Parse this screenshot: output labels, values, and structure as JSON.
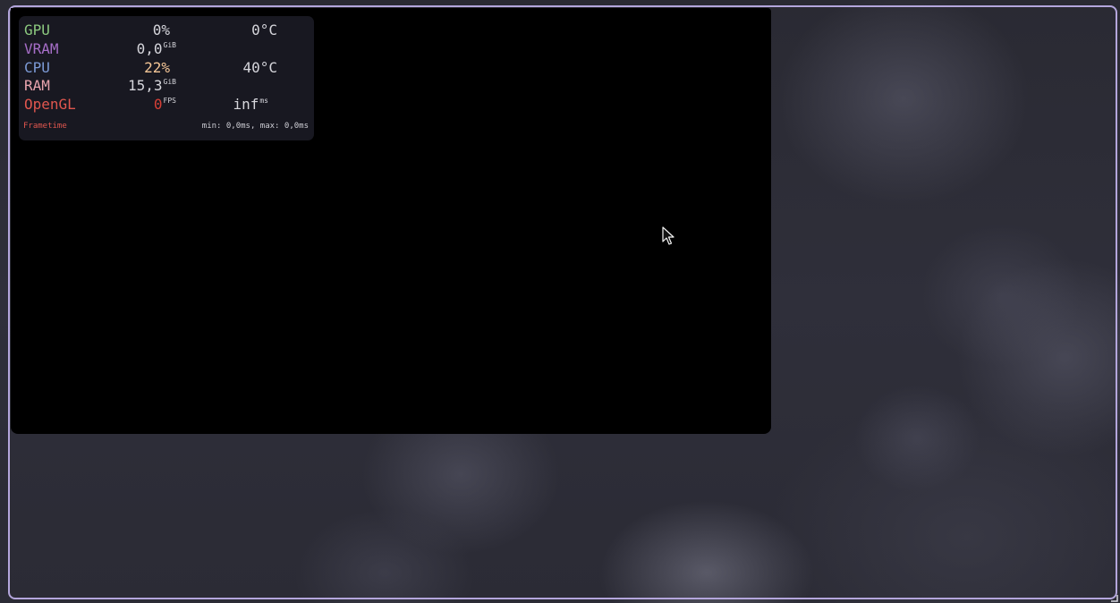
{
  "colors": {
    "gpu": "#8cc97f",
    "vram": "#a66ec8",
    "cpu": "#7c9ad6",
    "ram": "#e8a3ad",
    "opengl": "#e0564e",
    "cpu_load": "#f5c697",
    "fps_value": "#d83f36",
    "frame": "#b4a6dc"
  },
  "hud": {
    "gpu": {
      "label": "GPU",
      "load": "0%",
      "temp": "0°C"
    },
    "vram": {
      "label": "VRAM",
      "value": "0,0",
      "unit": "GiB"
    },
    "cpu": {
      "label": "CPU",
      "load": "22%",
      "temp": "40°C"
    },
    "ram": {
      "label": "RAM",
      "value": "15,3",
      "unit": "GiB"
    },
    "opengl": {
      "label": "OpenGL",
      "fps": "0",
      "fps_unit": "FPS",
      "frametime": "inf",
      "frametime_unit": "ms"
    },
    "frametime": {
      "label": "Frametime",
      "stats": "min: 0,0ms, max: 0,0ms"
    }
  },
  "icons": {
    "cursor": "mouse-pointer-icon",
    "resize": "resize-handle-icon"
  }
}
